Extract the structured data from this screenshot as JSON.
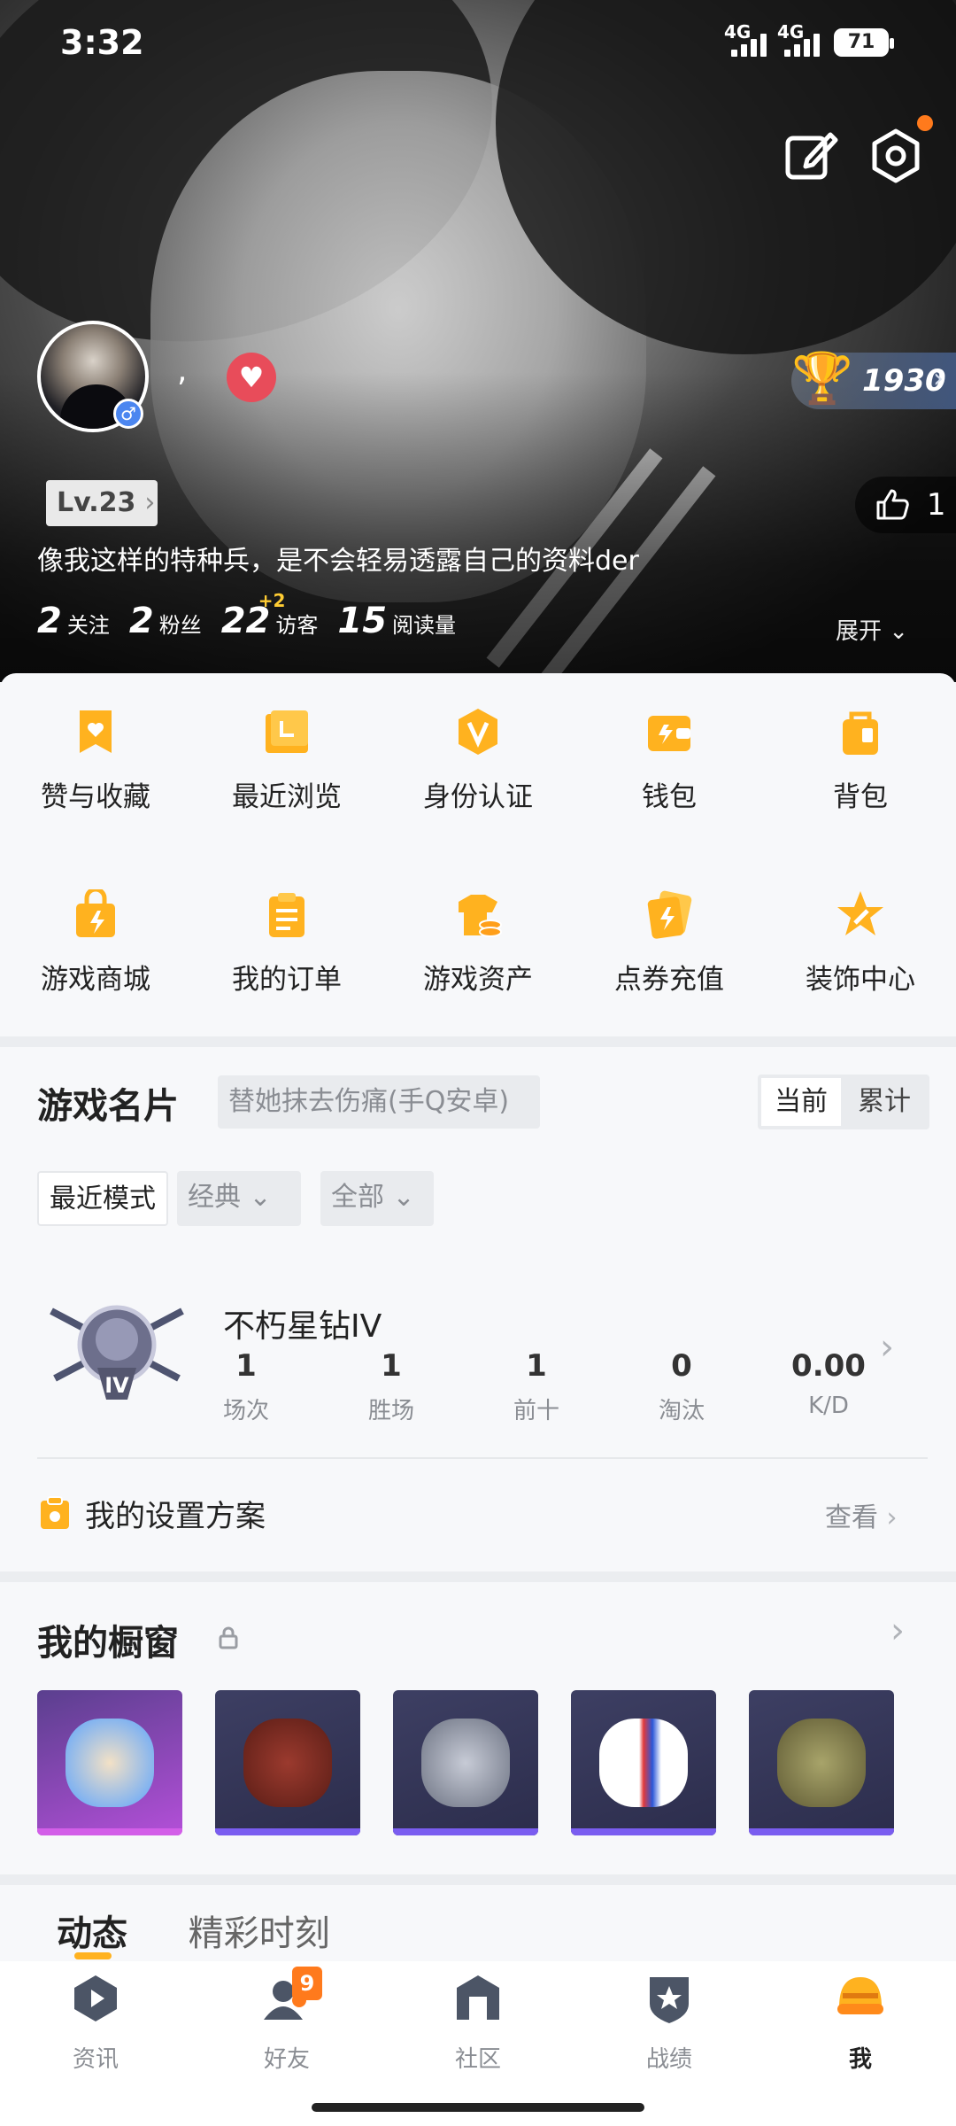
{
  "status_bar": {
    "time": "3:32",
    "net1": "4G",
    "net2": "4G",
    "battery": "71"
  },
  "profile": {
    "nickname": ",",
    "trophy_score": "1930",
    "level": "Lv.23",
    "likes": "1",
    "bio": "像我这样的特种兵，是不会轻易透露自己的资料der",
    "stats": [
      {
        "value": "2",
        "label": "关注"
      },
      {
        "value": "2",
        "label": "粉丝"
      },
      {
        "value": "22",
        "label": "访客",
        "delta": "+2"
      },
      {
        "value": "15",
        "label": "阅读量"
      }
    ],
    "expand_label": "展开"
  },
  "menu": [
    {
      "label": "赞与收藏",
      "icon": "bookmark-heart-icon"
    },
    {
      "label": "最近浏览",
      "icon": "history-folder-icon"
    },
    {
      "label": "身份认证",
      "icon": "verified-v-icon"
    },
    {
      "label": "钱包",
      "icon": "wallet-icon"
    },
    {
      "label": "背包",
      "icon": "backpack-icon"
    },
    {
      "label": "游戏商城",
      "icon": "shopping-bag-icon"
    },
    {
      "label": "我的订单",
      "icon": "clipboard-icon"
    },
    {
      "label": "游戏资产",
      "icon": "tshirt-coins-icon"
    },
    {
      "label": "点券充值",
      "icon": "card-topup-icon"
    },
    {
      "label": "装饰中心",
      "icon": "star-brush-icon"
    }
  ],
  "game_card": {
    "title": "游戏名片",
    "server": "替她抹去伤痛(手Q安卓)",
    "seg_current": "当前",
    "seg_total": "累计",
    "filter_mode": "最近模式",
    "filter_classic": "经典",
    "filter_all": "全部",
    "rank_name": "不朽星钻IV",
    "rank_tier": "IV",
    "stats": [
      {
        "value": "1",
        "label": "场次"
      },
      {
        "value": "1",
        "label": "胜场"
      },
      {
        "value": "1",
        "label": "前十"
      },
      {
        "value": "0",
        "label": "淘汰"
      },
      {
        "value": "0.00",
        "label": "K/D"
      }
    ],
    "setup_label": "我的设置方案",
    "view_label": "查看"
  },
  "showcase": {
    "title": "我的橱窗"
  },
  "feed_tabs": {
    "active": "动态",
    "other": "精彩时刻"
  },
  "nav": [
    {
      "label": "资讯"
    },
    {
      "label": "好友",
      "badge": "9"
    },
    {
      "label": "社区"
    },
    {
      "label": "战绩"
    },
    {
      "label": "我"
    }
  ],
  "colors": {
    "accent": "#ffb21f",
    "nav_active": "#222222",
    "purple_item": "#9b45d6"
  }
}
